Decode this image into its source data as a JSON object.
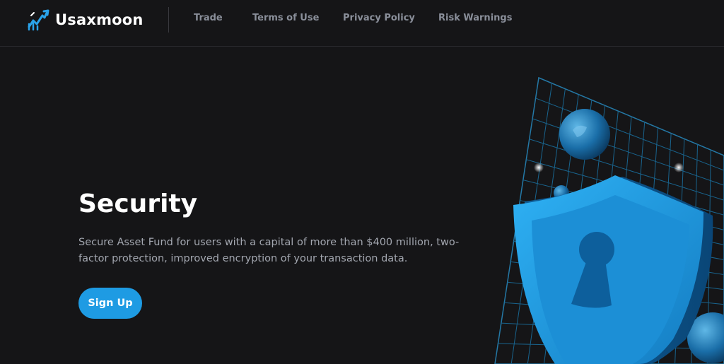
{
  "brand": {
    "name": "Usaxmoon",
    "icon": "trend-arrow-logo-icon",
    "accent": "#1e9be3"
  },
  "nav": {
    "items": [
      {
        "label": "Trade"
      },
      {
        "label": "Terms of Use"
      },
      {
        "label": "Privacy Policy"
      },
      {
        "label": "Risk Warnings"
      }
    ]
  },
  "hero": {
    "title": "Security",
    "description": "Secure Asset Fund for users with a capital of more than $400 million, two-factor protection, improved encryption of your transaction data.",
    "cta_label": "Sign Up",
    "illustration": "shield-with-keyhole-illustration"
  },
  "colors": {
    "background": "#151517",
    "text_muted": "#a3a7b0",
    "nav_text": "#8a8f9a",
    "button": "#1e9be3"
  }
}
